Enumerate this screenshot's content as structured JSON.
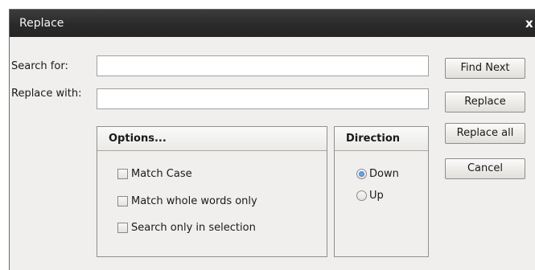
{
  "window": {
    "title": "Replace",
    "close_glyph": "x"
  },
  "fields": {
    "search_label": "Search for:",
    "search_value": "",
    "replace_label": "Replace with:",
    "replace_value": ""
  },
  "buttons": {
    "find_next": "Find Next",
    "replace": "Replace",
    "replace_all": "Replace all",
    "cancel": "Cancel"
  },
  "options": {
    "header": "Options...",
    "items": [
      {
        "label": "Match Case",
        "checked": false
      },
      {
        "label": "Match whole words only",
        "checked": false
      },
      {
        "label": "Search only in selection",
        "checked": false
      }
    ]
  },
  "direction": {
    "header": "Direction",
    "items": [
      {
        "label": "Down",
        "selected": true
      },
      {
        "label": "Up",
        "selected": false
      }
    ]
  },
  "colors": {
    "titlebar": "#2e2e2e",
    "dialog_bg": "#f0efed",
    "radio_selected": "#2c6fc4"
  }
}
